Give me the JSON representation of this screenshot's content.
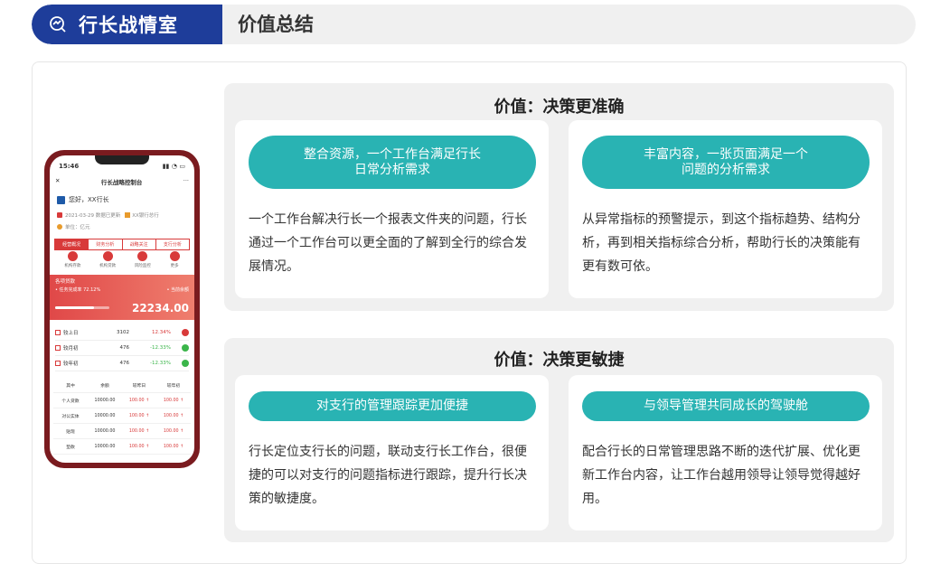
{
  "header": {
    "brand_title": "行长战情室",
    "breadcrumb": "价值总结"
  },
  "phone": {
    "time": "15:46",
    "app_title": "行长战略控制台",
    "close": "✕",
    "more": "···",
    "greeting": "您好，XX行长",
    "update_info": "2021-03-29 数据已更新",
    "branch": "XX银行总行",
    "unit": "单位：亿元",
    "tabs": [
      "经营概况",
      "财务分析",
      "战略关注",
      "支行分析"
    ],
    "icons": [
      "机构存款",
      "机构贷款",
      "风险监控",
      "更多"
    ],
    "banner_title": "各项贷款",
    "banner_task": "• 任务完成率 72.12%",
    "banner_task_rate": 0.7212,
    "banner_current": "• 当前余额",
    "banner_value": "22234.00",
    "rows": [
      {
        "label": "较上日",
        "value": "3102",
        "change": "12.34%",
        "color": "#d83a3a"
      },
      {
        "label": "较月初",
        "value": "476",
        "change": "-12.33%",
        "color": "#3bb54a"
      },
      {
        "label": "较年初",
        "value": "476",
        "change": "-12.33%",
        "color": "#3bb54a"
      }
    ],
    "table_header": [
      "其中",
      "余额",
      "较昨日",
      "较年初"
    ],
    "table_rows": [
      [
        "个人贷款",
        "10000.00",
        "100.00 ↑",
        "100.00 ↑"
      ],
      [
        "对公实体",
        "10000.00",
        "100.00 ↑",
        "100.00 ↑"
      ],
      [
        "贴现",
        "10000.00",
        "100.00 ↑",
        "100.00 ↑"
      ],
      [
        "垫款",
        "10000.00",
        "100.00 ↑",
        "100.00 ↑"
      ]
    ]
  },
  "panel1": {
    "title": "价值：决策更准确",
    "left_pill": "整合资源，一个工作台满足行长\n日常分析需求",
    "left_desc": "一个工作台解决行长一个报表文件夹的问题，行长通过一个工作台可以更全面的了解到全行的综合发展情况。",
    "right_pill": "丰富内容，一张页面满足一个\n问题的分析需求",
    "right_desc": "从异常指标的预警提示，到这个指标趋势、结构分析，再到相关指标综合分析，帮助行长的决策能有更有数可依。"
  },
  "panel2": {
    "title": "价值：决策更敏捷",
    "left_pill": "对支行的管理跟踪更加便捷",
    "left_desc": "行长定位支行长的问题，联动支行长工作台，很便捷的可以对支行的问题指标进行跟踪，提升行长决策的敏捷度。",
    "right_pill": "与领导管理共同成长的驾驶舱",
    "right_desc": "配合行长的日常管理思路不断的迭代扩展、优化更新工作台内容，让工作台越用领导让领导觉得越好用。"
  },
  "colors": {
    "brand": "#1e3d9a",
    "pill": "#29b3b3",
    "phone_frame": "#7a1b1f",
    "accent_red": "#d83a3a"
  }
}
